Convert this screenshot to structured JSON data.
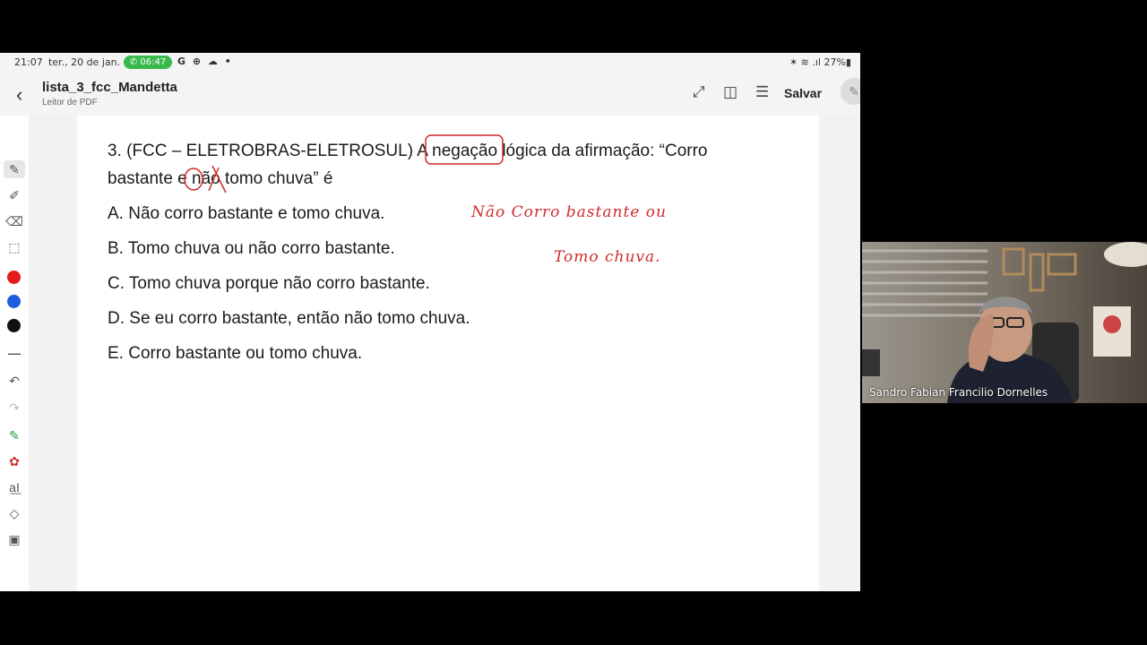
{
  "status_bar": {
    "time": "21:07",
    "date": "ter., 20 de jan.",
    "call_timer": "06:47",
    "right_icons": "✶ ≋ .ıl 27%▮"
  },
  "app_bar": {
    "back_icon": "chevron-left-icon",
    "title": "lista_3_fcc_Mandetta",
    "subtitle": "Leitor de PDF",
    "save_label": "Salvar"
  },
  "toolbar": {
    "colors": [
      "#e21b1b",
      "#1f5de0",
      "#111111"
    ]
  },
  "document": {
    "question_line1": "3. (FCC – ELETROBRAS-ELETROSUL) A negação lógica da afirmação: “Corro",
    "question_line2": "bastante e não tomo chuva” é",
    "options": [
      "A. Não corro bastante e tomo chuva.",
      "B. Tomo chuva ou não corro bastante.",
      "C. Tomo chuva porque não corro bastante.",
      "D. Se eu corro bastante, então não tomo chuva.",
      "E. Corro bastante ou tomo chuva."
    ],
    "handwriting_line1": "Não Corro bastante ou",
    "handwriting_line2": "Tomo chuva."
  },
  "webcam": {
    "participant_name": "Sandro Fabian Francilio Dornelles"
  }
}
